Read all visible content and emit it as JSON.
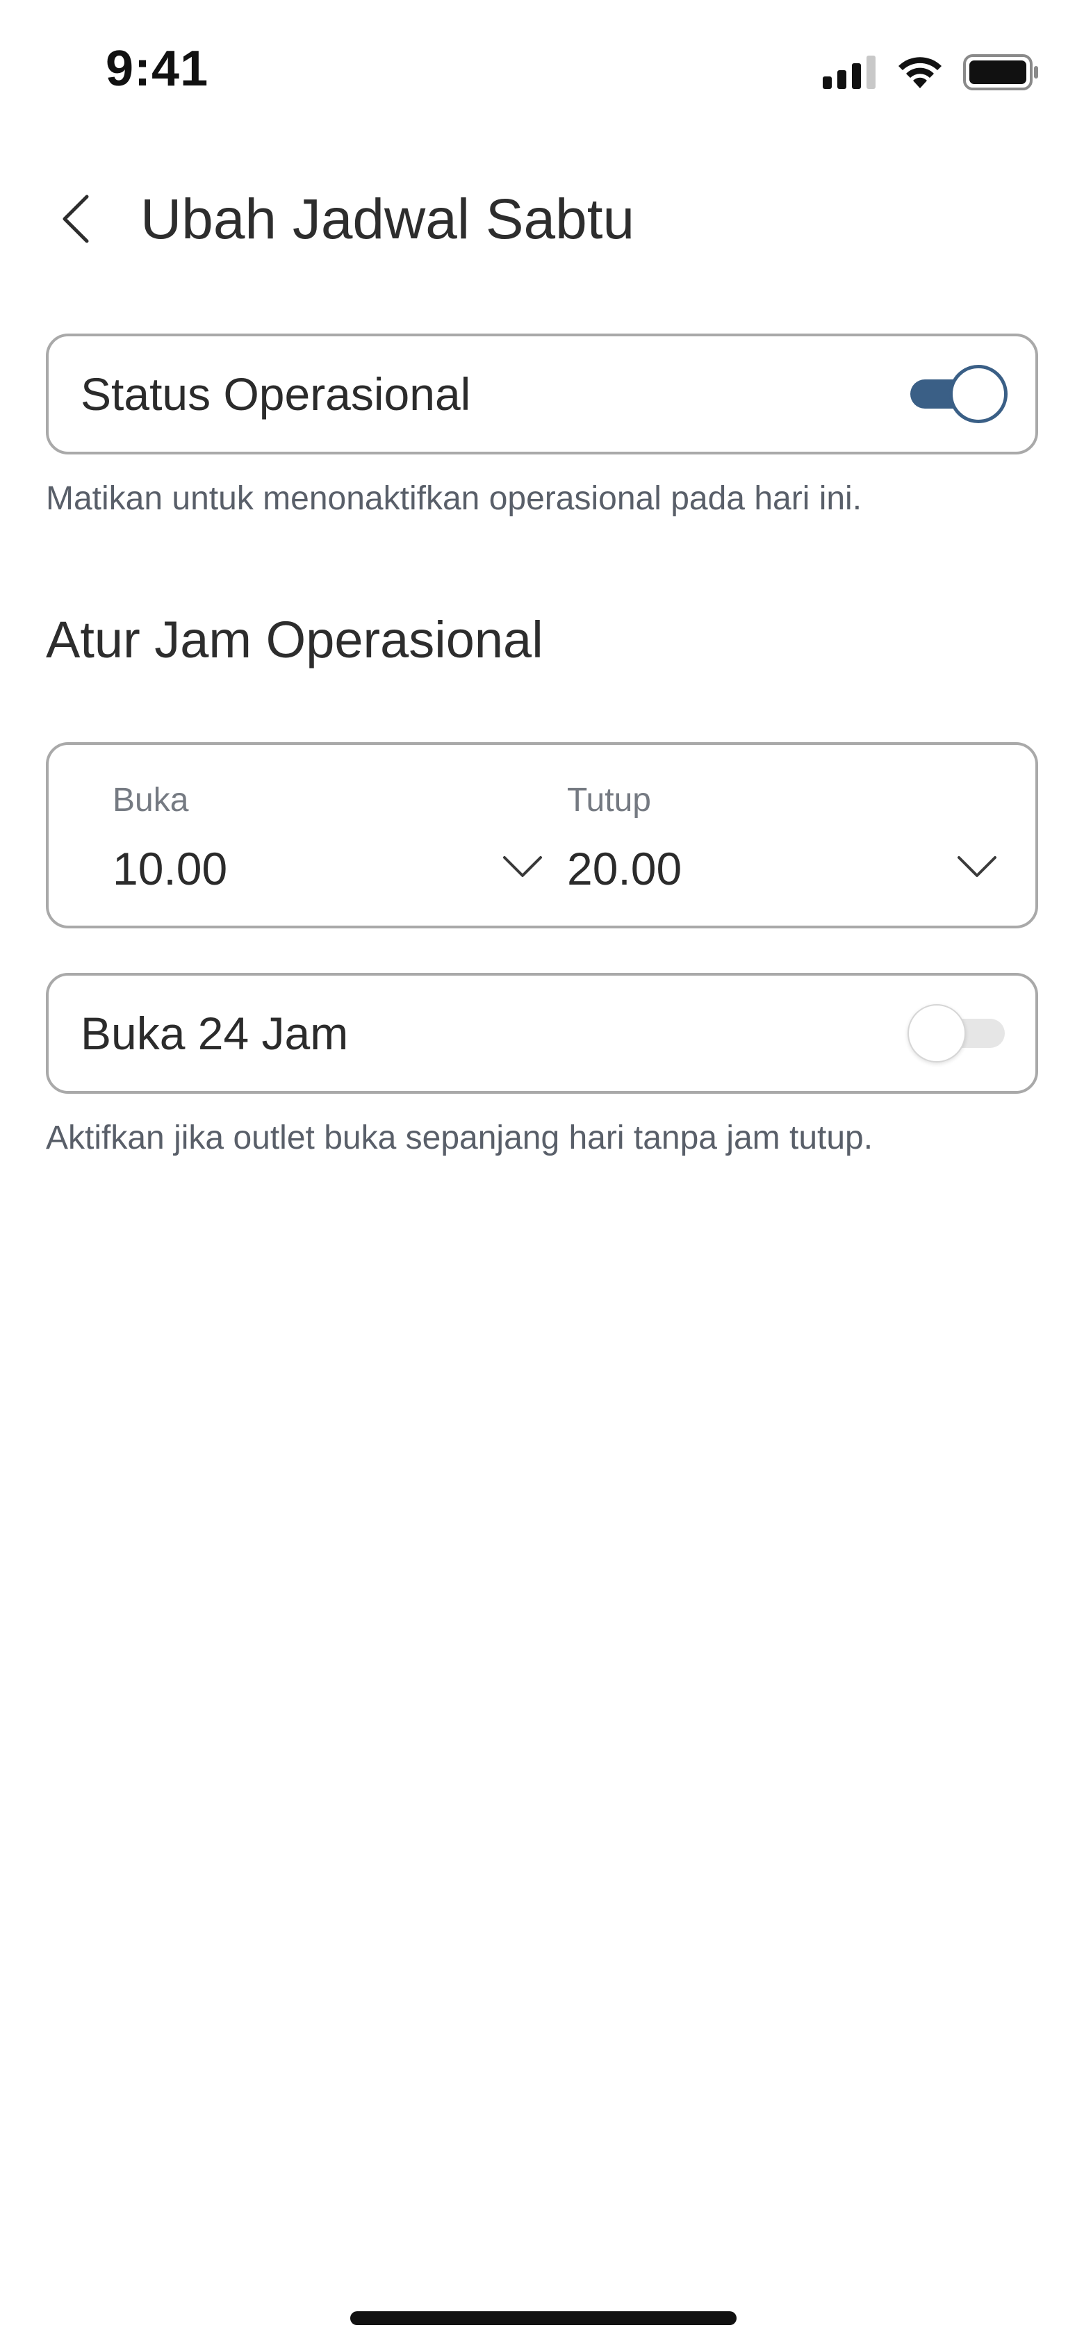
{
  "status_bar": {
    "time": "9:41",
    "icons": [
      "signal-icon",
      "wifi-icon",
      "battery-icon"
    ]
  },
  "header": {
    "back_icon": "chevron-left-icon",
    "title": "Ubah Jadwal Sabtu"
  },
  "operational_status": {
    "label": "Status Operasional",
    "enabled": true,
    "helper": "Matikan untuk menonaktifkan operasional pada hari ini."
  },
  "hours": {
    "section_title": "Atur Jam Operasional",
    "open": {
      "label": "Buka",
      "value": "10.00",
      "icon": "chevron-down-icon"
    },
    "close": {
      "label": "Tutup",
      "value": "20.00",
      "icon": "chevron-down-icon"
    }
  },
  "open_24h": {
    "label": "Buka 24 Jam",
    "enabled": false,
    "helper": "Aktifkan jika outlet buka sepanjang hari tanpa jam tutup."
  },
  "colors": {
    "accent": "#3a5f86",
    "border": "#a9a9a9",
    "text": "#2b2b2b",
    "muted": "#595f69"
  }
}
